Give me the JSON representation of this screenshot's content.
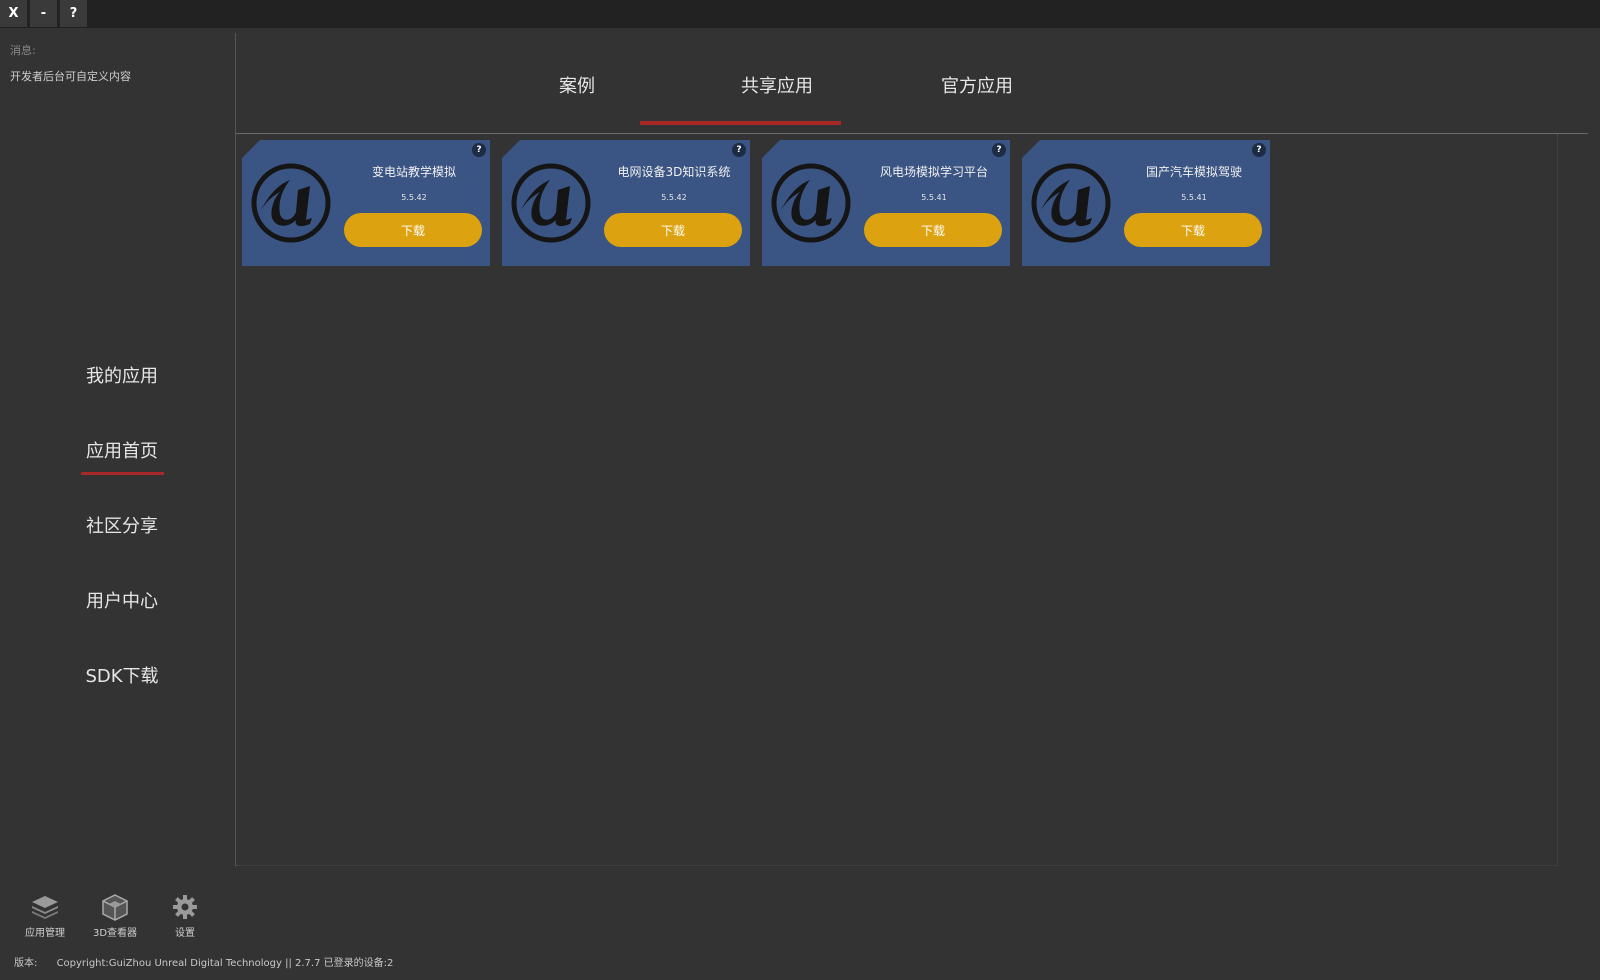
{
  "window": {
    "close_label": "X",
    "minimize_label": "-",
    "help_label": "?"
  },
  "sidebar": {
    "message_label": "消息:",
    "message_content": "开发者后台可自定义内容",
    "nav": [
      {
        "label": "我的应用"
      },
      {
        "label": "应用首页",
        "active": true
      },
      {
        "label": "社区分享"
      },
      {
        "label": "用户中心"
      },
      {
        "label": "SDK下载"
      }
    ],
    "tools": [
      {
        "label": "应用管理",
        "icon": "layers-icon"
      },
      {
        "label": "3D查看器",
        "icon": "cube-icon"
      },
      {
        "label": "设置",
        "icon": "gear-icon"
      }
    ],
    "footer": {
      "version_label": "版本:",
      "copyright": "Copyright:GuiZhou Unreal Digital Technology || 2.7.7 已登录的设备:2"
    }
  },
  "tabs": [
    {
      "label": "案例"
    },
    {
      "label": "共享应用"
    },
    {
      "label": "官方应用",
      "active": true
    }
  ],
  "apps": [
    {
      "title": "变电站教学模拟",
      "version": "5.5.42",
      "button": "下载",
      "help": "?"
    },
    {
      "title": "电网设备3D知识系统",
      "version": "5.5.42",
      "button": "下载",
      "help": "?"
    },
    {
      "title": "风电场模拟学习平台",
      "version": "5.5.41",
      "button": "下载",
      "help": "?"
    },
    {
      "title": "国产汽车模拟驾驶",
      "version": "5.5.41",
      "button": "下载",
      "help": "?"
    }
  ],
  "colors": {
    "background": "#333333",
    "card": "#3a5483",
    "accent_underline": "#a82828",
    "download_button": "#dda20f"
  }
}
